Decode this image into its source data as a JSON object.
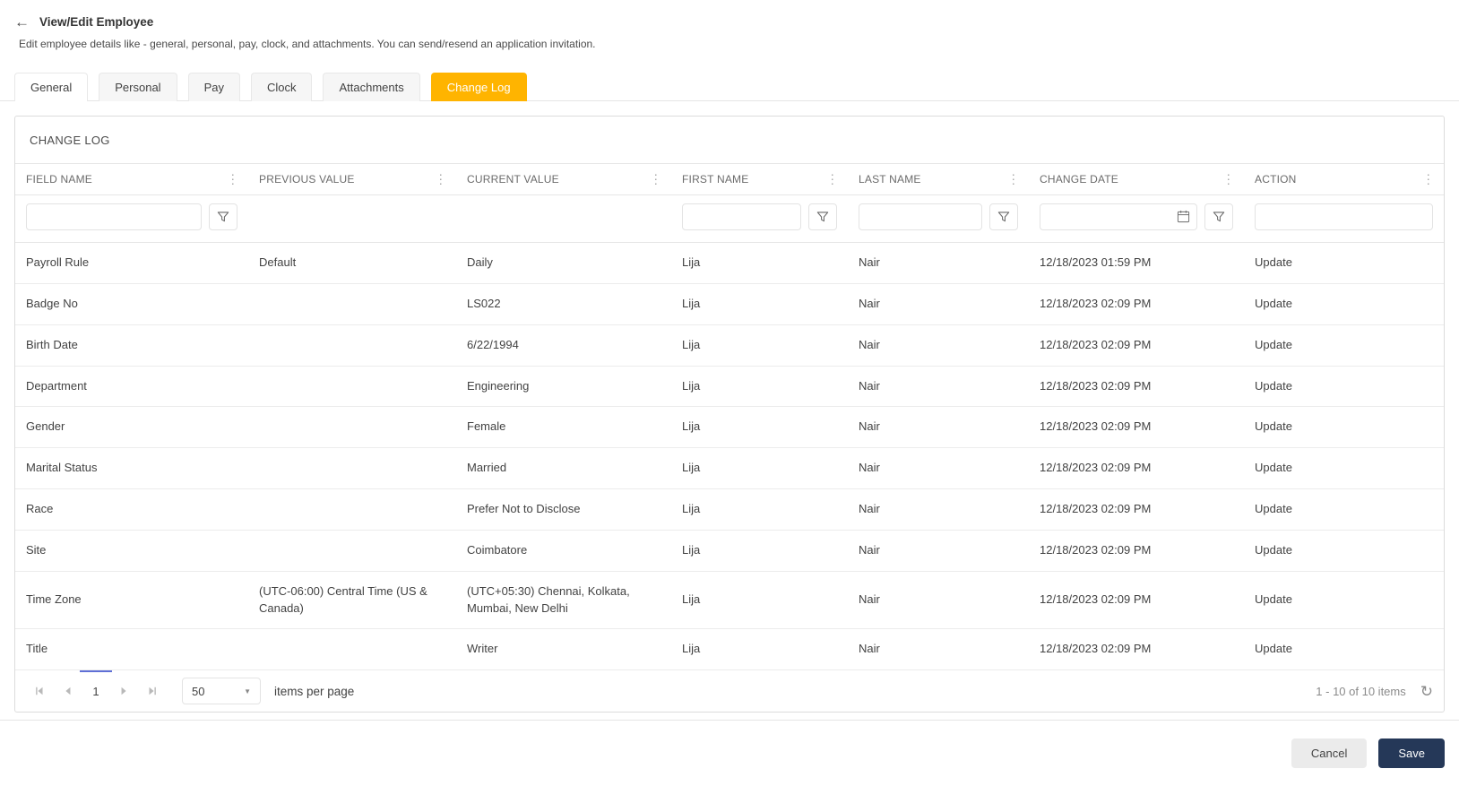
{
  "header": {
    "title": "View/Edit Employee",
    "subtitle": "Edit employee details like - general, personal, pay, clock, and attachments. You can send/resend an application invitation."
  },
  "icons": {
    "back": "←",
    "kebab": "⋮",
    "dropdown_caret": "▼",
    "refresh": "↻"
  },
  "colors": {
    "accent": "#ffb400",
    "save": "#253858",
    "page_indicator": "#5f6fd6"
  },
  "tabs": [
    {
      "label": "General",
      "active": false
    },
    {
      "label": "Personal",
      "active": false
    },
    {
      "label": "Pay",
      "active": false
    },
    {
      "label": "Clock",
      "active": false
    },
    {
      "label": "Attachments",
      "active": false
    },
    {
      "label": "Change Log",
      "active": true
    }
  ],
  "panel": {
    "title": "CHANGE LOG"
  },
  "table": {
    "columns": [
      "FIELD NAME",
      "PREVIOUS VALUE",
      "CURRENT VALUE",
      "FIRST NAME",
      "LAST NAME",
      "CHANGE DATE",
      "ACTION"
    ],
    "rows": [
      {
        "field": "Payroll Rule",
        "previous": "Default",
        "current": "Daily",
        "first": "Lija",
        "last": "Nair",
        "date": "12/18/2023 01:59 PM",
        "action": "Update"
      },
      {
        "field": "Badge No",
        "previous": "",
        "current": "LS022",
        "first": "Lija",
        "last": "Nair",
        "date": "12/18/2023 02:09 PM",
        "action": "Update"
      },
      {
        "field": "Birth Date",
        "previous": "",
        "current": "6/22/1994",
        "first": "Lija",
        "last": "Nair",
        "date": "12/18/2023 02:09 PM",
        "action": "Update"
      },
      {
        "field": "Department",
        "previous": "",
        "current": "Engineering",
        "first": "Lija",
        "last": "Nair",
        "date": "12/18/2023 02:09 PM",
        "action": "Update"
      },
      {
        "field": "Gender",
        "previous": "",
        "current": "Female",
        "first": "Lija",
        "last": "Nair",
        "date": "12/18/2023 02:09 PM",
        "action": "Update"
      },
      {
        "field": "Marital Status",
        "previous": "",
        "current": "Married",
        "first": "Lija",
        "last": "Nair",
        "date": "12/18/2023 02:09 PM",
        "action": "Update"
      },
      {
        "field": "Race",
        "previous": "",
        "current": "Prefer Not to Disclose",
        "first": "Lija",
        "last": "Nair",
        "date": "12/18/2023 02:09 PM",
        "action": "Update"
      },
      {
        "field": "Site",
        "previous": "",
        "current": "Coimbatore",
        "first": "Lija",
        "last": "Nair",
        "date": "12/18/2023 02:09 PM",
        "action": "Update"
      },
      {
        "field": "Time Zone",
        "previous": "(UTC-06:00) Central Time (US & Canada)",
        "current": "(UTC+05:30) Chennai, Kolkata, Mumbai, New Delhi",
        "first": "Lija",
        "last": "Nair",
        "date": "12/18/2023 02:09 PM",
        "action": "Update"
      },
      {
        "field": "Title",
        "previous": "",
        "current": "Writer",
        "first": "Lija",
        "last": "Nair",
        "date": "12/18/2023 02:09 PM",
        "action": "Update"
      }
    ]
  },
  "filters": {
    "field_name": "",
    "first_name": "",
    "last_name": "",
    "change_date": "",
    "action": ""
  },
  "pager": {
    "page": "1",
    "page_size": "50",
    "items_per_page_label": "items per page",
    "range_label": "1 - 10 of 10 items"
  },
  "footer": {
    "cancel_label": "Cancel",
    "save_label": "Save"
  }
}
